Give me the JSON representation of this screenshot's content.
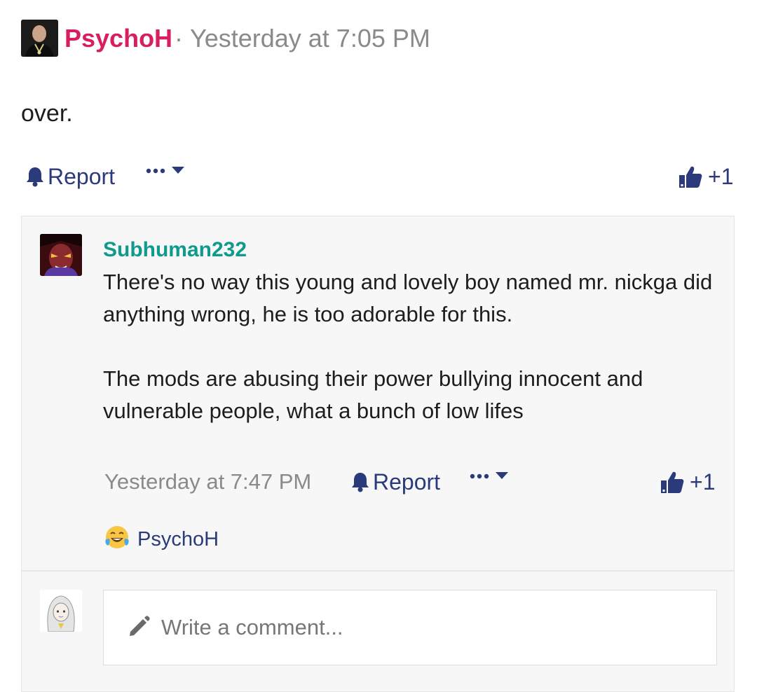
{
  "post": {
    "author": "PsychoH",
    "separator": "·",
    "time": "Yesterday at 7:05 PM",
    "body": "over.",
    "report_label": "Report",
    "like_count": "+1"
  },
  "comment": {
    "author": "Subhuman232",
    "paragraphs": [
      "There's no way this young and lovely boy named mr. nickga did anything wrong, he is too adorable for this.",
      "The mods are abusing their power bullying innocent and vulnerable people, what a bunch of low lifes"
    ],
    "time": "Yesterday at 7:47 PM",
    "report_label": "Report",
    "like_count": "+1",
    "reaction": {
      "icon": "laughing-tears-emoji-icon",
      "user": "PsychoH"
    }
  },
  "composer": {
    "placeholder": "Write a comment..."
  },
  "colors": {
    "author_pink": "#d81e62",
    "author_teal": "#0f9a8e",
    "action_blue": "#2b3a7a",
    "muted": "#8a8a8a"
  }
}
